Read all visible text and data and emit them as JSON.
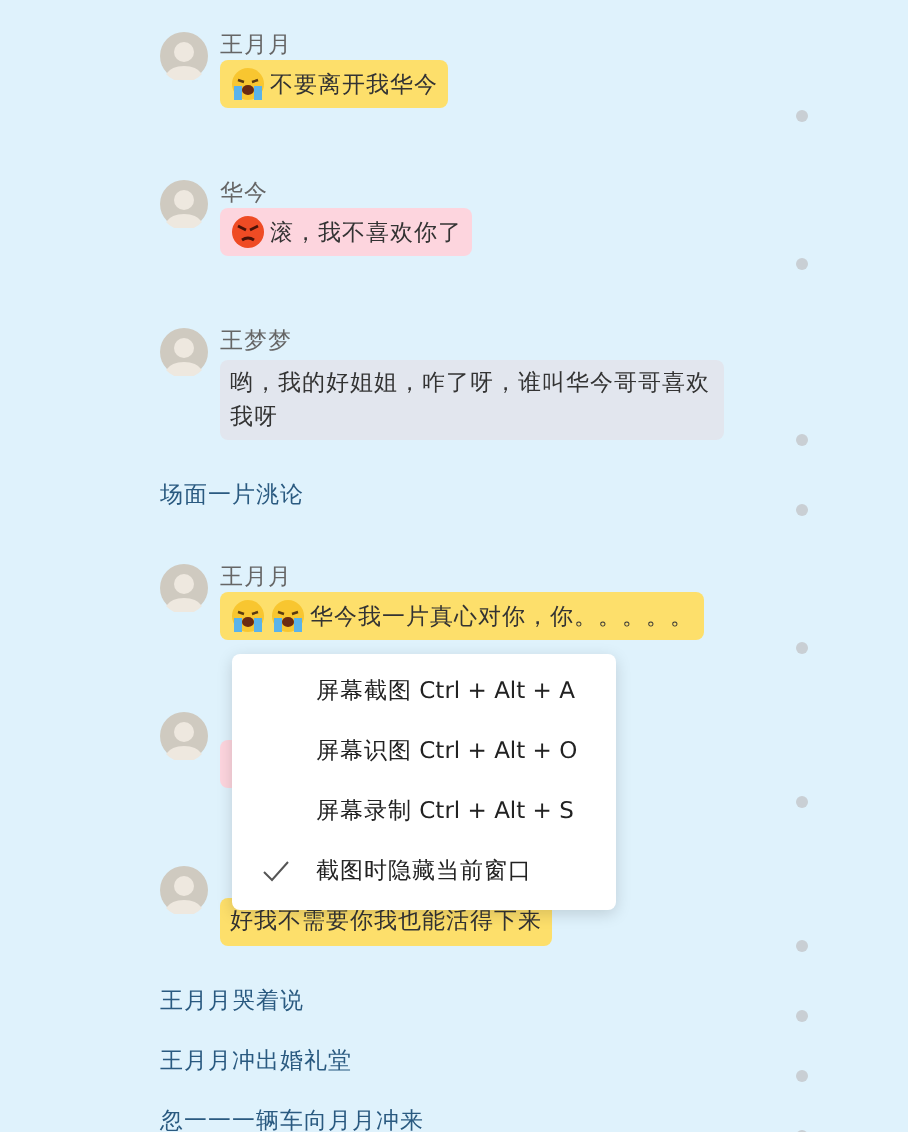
{
  "messages": [
    {
      "kind": "message",
      "sender": "王月月",
      "color": "#fddf6b",
      "emojis": [
        {
          "kind": "crying"
        }
      ],
      "text": "不要离开我华今"
    },
    {
      "kind": "message",
      "sender": "华今",
      "color": "#fdd5de",
      "emojis": [
        {
          "kind": "angry"
        }
      ],
      "text": "滚，我不喜欢你了"
    },
    {
      "kind": "message",
      "sender": "王梦梦",
      "color": "#e2e6ee",
      "text": "哟，我的好姐姐，咋了呀，谁叫华今哥哥喜欢我呀"
    },
    {
      "kind": "narration",
      "text": "场面一片洮论"
    },
    {
      "kind": "message",
      "sender": "王月月",
      "color": "#fddf6b",
      "emojis": [
        {
          "kind": "crying"
        },
        {
          "kind": "crying"
        }
      ],
      "text": "华今我一片真心对你，你。。。。。"
    },
    {
      "kind": "message",
      "color": "#fdd5de"
    },
    {
      "kind": "message",
      "color": "#fddf6b",
      "text": "好我不需要你我也能活得下来"
    },
    {
      "kind": "narration",
      "text": "王月月哭着说"
    },
    {
      "kind": "narration",
      "text": "王月月冲出婚礼堂"
    },
    {
      "kind": "narration",
      "text": "忽一一一辆车向月月冲来"
    }
  ],
  "context_menu": [
    {
      "label": "屏幕截图 Ctrl + Alt + A",
      "checked": false
    },
    {
      "label": "屏幕识图 Ctrl + Alt + O",
      "checked": false
    },
    {
      "label": "屏幕录制 Ctrl + Alt + S",
      "checked": false
    },
    {
      "label": "截图时隐藏当前窗口",
      "checked": true
    }
  ]
}
